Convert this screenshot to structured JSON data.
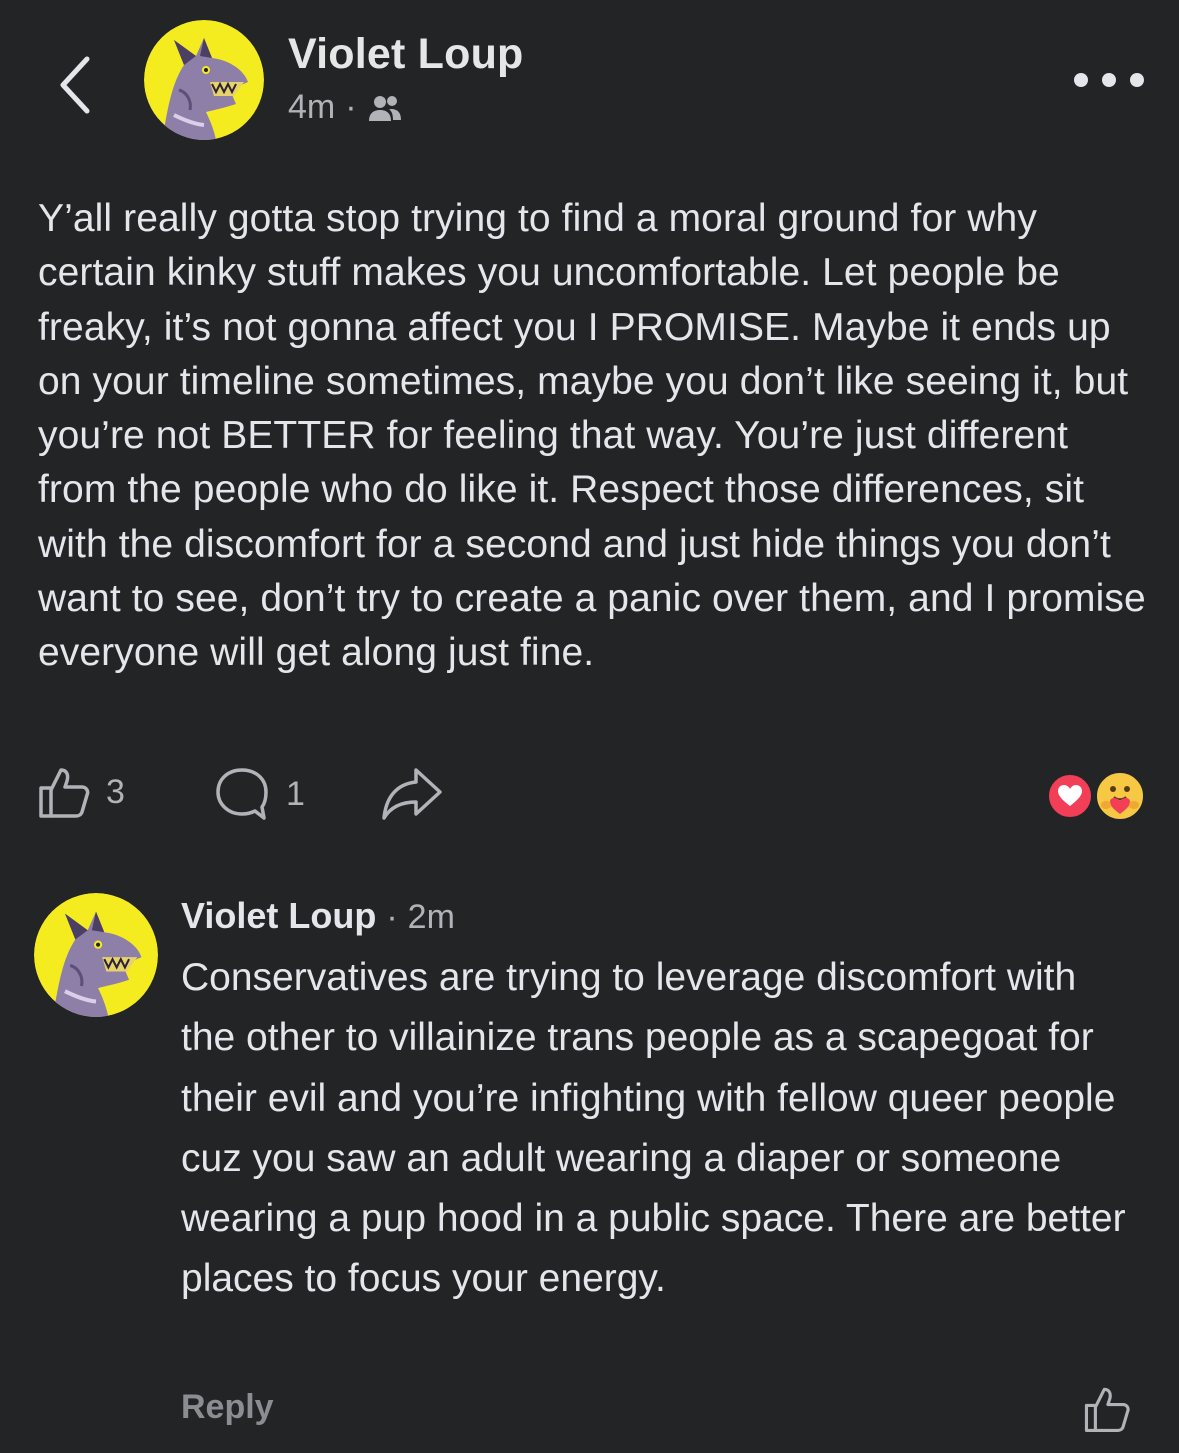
{
  "post": {
    "author": "Violet Loup",
    "time": "4m",
    "separator": "·",
    "audience_icon": "friends-icon",
    "body": "Y’all really gotta stop trying to find a moral ground for why certain kinky stuff makes you uncomfortable. Let people be freaky, it’s not gonna affect you I PROMISE. Maybe it ends up on your timeline sometimes, maybe you don’t like seeing it, but you’re not BETTER for feeling that way. You’re just different from the people who do like it. Respect those differences, sit with the discomfort for a second and just hide things you don’t want to see, don’t try to create a panic over them, and I promise everyone will get along just fine.",
    "like_count": "3",
    "comment_count": "1",
    "reactions": [
      "love",
      "care"
    ]
  },
  "comment": {
    "author": "Violet Loup",
    "separator": "·",
    "time": "2m",
    "body": "Conservatives are trying to leverage discomfort with the other to villainize trans people as a scapegoat for their evil and you’re infighting with fellow queer people cuz you saw an adult wearing a diaper or someone wearing a pup hood in a public space. There are better places to focus your energy.",
    "reply_label": "Reply"
  },
  "colors": {
    "background": "#232426",
    "text": "#e4e6eb",
    "secondary_text": "#b0b3b8",
    "love": "#f33e58",
    "care": "#f7c843",
    "avatar_bg": "#f5ec1f"
  }
}
